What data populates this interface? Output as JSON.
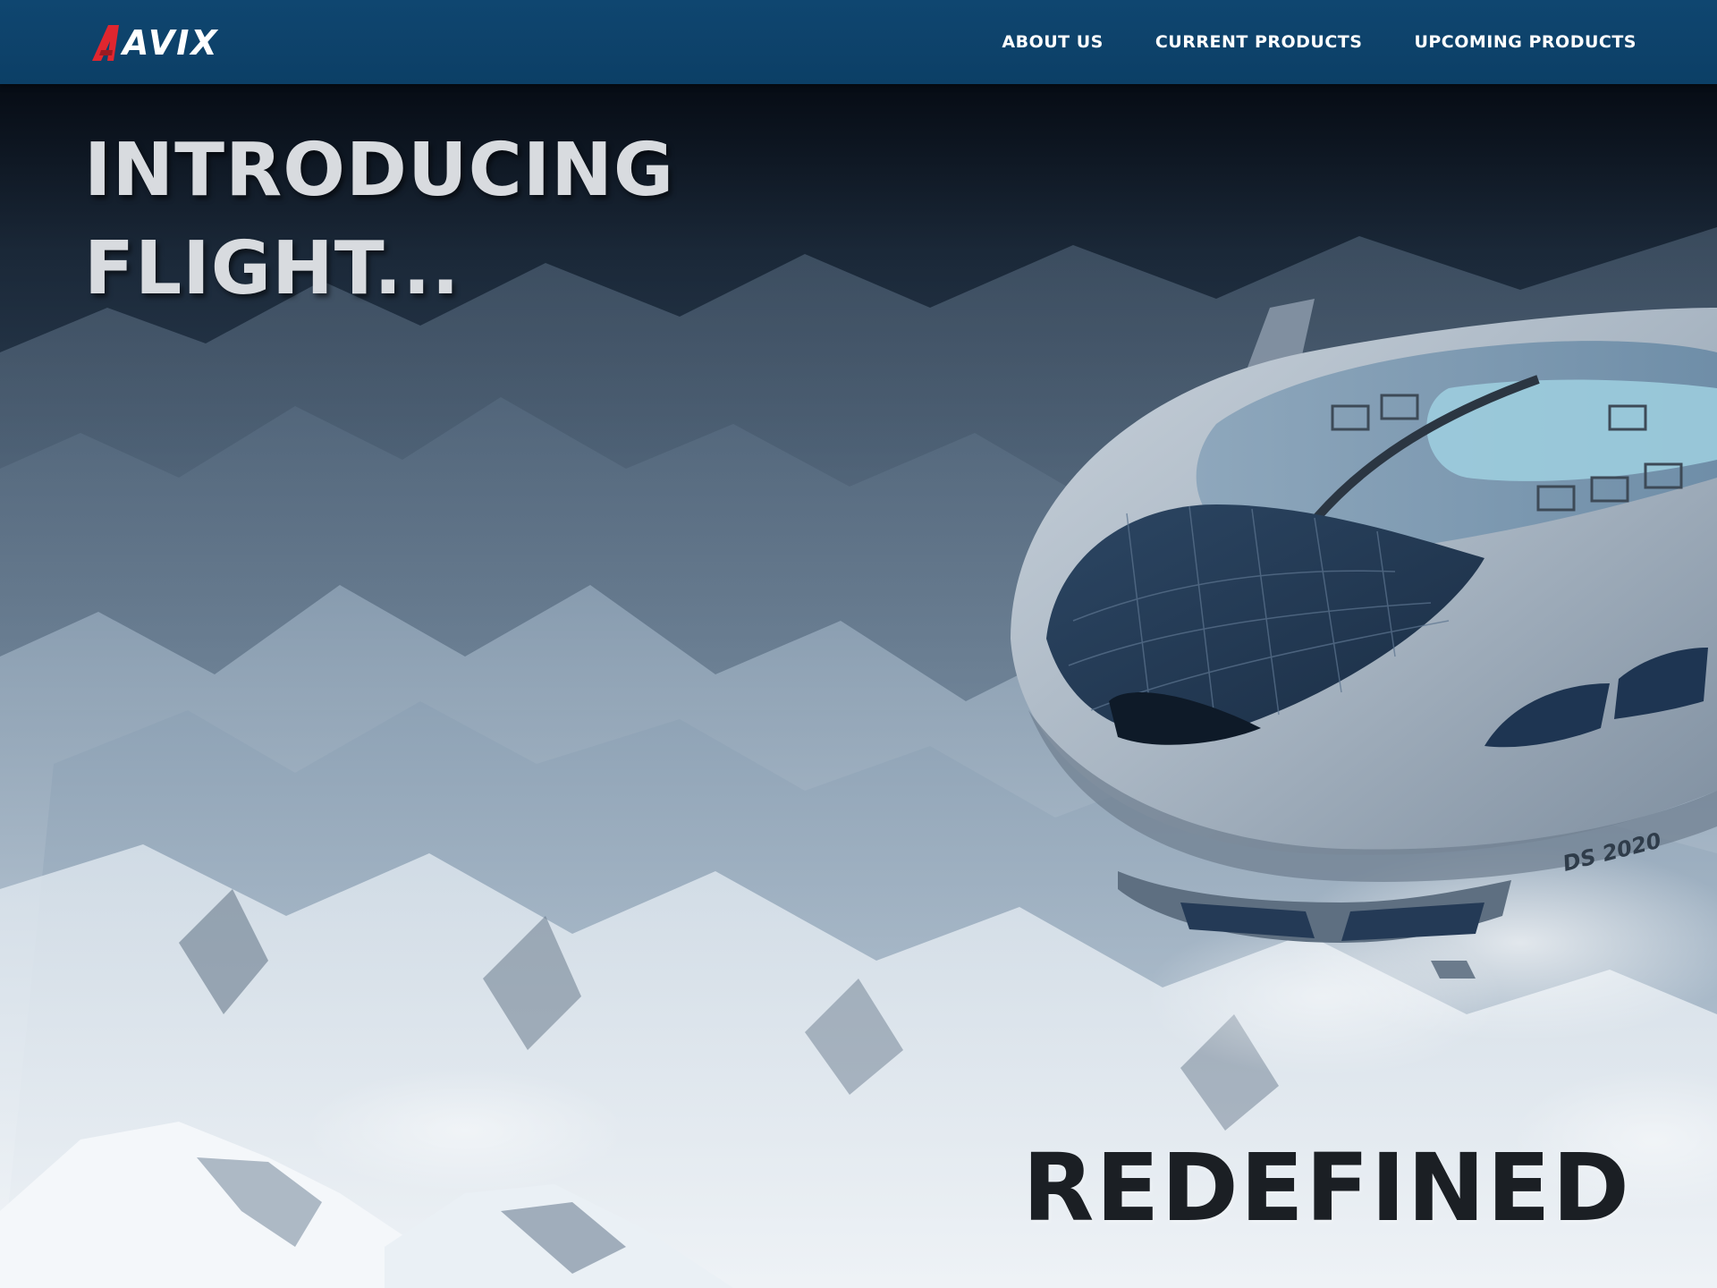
{
  "brand": {
    "name": "AVIX",
    "accent_color": "#e0262f",
    "logo_icon": "avix-logo-mark"
  },
  "nav": {
    "items": [
      {
        "label": "ABOUT US"
      },
      {
        "label": "CURRENT PRODUCTS"
      },
      {
        "label": "UPCOMING PRODUCTS"
      }
    ]
  },
  "hero": {
    "headline_line1": "INTRODUCING",
    "headline_line2": "FLIGHT...",
    "tagline": "REDEFINED",
    "airship_marking": "DS 2020",
    "image_subject": "airship-over-snowy-mountains"
  },
  "colors": {
    "navbar": "#0f4670",
    "headline_text": "#d8dbdf",
    "tagline_text": "#1b1f24"
  }
}
